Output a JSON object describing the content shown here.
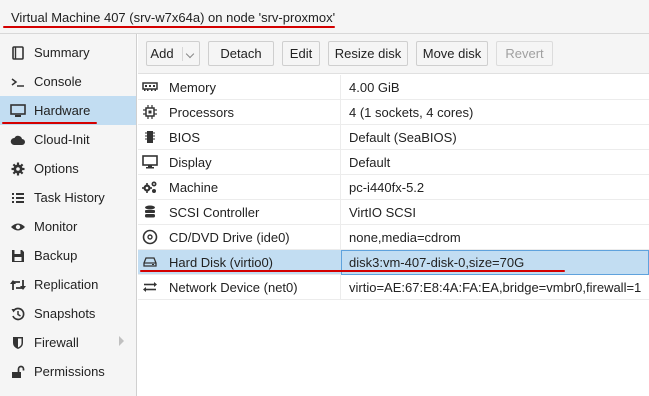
{
  "title": "Virtual Machine 407 (srv-w7x64a) on node 'srv-proxmox'",
  "colors": {
    "accent_selected": "#c2ddf2",
    "annotation_red": "#d40000",
    "focus_border": "#5fa2dd"
  },
  "sidebar": {
    "items": [
      {
        "label": "Summary",
        "icon": "book-icon"
      },
      {
        "label": "Console",
        "icon": "terminal-icon"
      },
      {
        "label": "Hardware",
        "icon": "monitor-icon",
        "active": true
      },
      {
        "label": "Cloud-Init",
        "icon": "cloud-icon"
      },
      {
        "label": "Options",
        "icon": "gear-icon"
      },
      {
        "label": "Task History",
        "icon": "list-icon"
      },
      {
        "label": "Monitor",
        "icon": "eye-icon"
      },
      {
        "label": "Backup",
        "icon": "floppy-icon"
      },
      {
        "label": "Replication",
        "icon": "retweet-icon"
      },
      {
        "label": "Snapshots",
        "icon": "history-icon"
      },
      {
        "label": "Firewall",
        "icon": "shield-icon"
      },
      {
        "label": "Permissions",
        "icon": "unlock-icon"
      }
    ]
  },
  "toolbar": {
    "add": "Add",
    "detach": "Detach",
    "edit": "Edit",
    "resize_disk": "Resize disk",
    "move_disk": "Move disk",
    "revert": "Revert"
  },
  "hardware": {
    "rows": [
      {
        "key": "Memory",
        "value": "4.00 GiB",
        "icon": "memory-icon"
      },
      {
        "key": "Processors",
        "value": "4 (1 sockets, 4 cores)",
        "icon": "cpu-icon"
      },
      {
        "key": "BIOS",
        "value": "Default (SeaBIOS)",
        "icon": "microchip-icon"
      },
      {
        "key": "Display",
        "value": "Default",
        "icon": "desktop-icon"
      },
      {
        "key": "Machine",
        "value": "pc-i440fx-5.2",
        "icon": "cogs-icon"
      },
      {
        "key": "SCSI Controller",
        "value": "VirtIO SCSI",
        "icon": "database-icon"
      },
      {
        "key": "CD/DVD Drive (ide0)",
        "value": "none,media=cdrom",
        "icon": "cdrom-icon"
      },
      {
        "key": "Hard Disk (virtio0)",
        "value": "disk3:vm-407-disk-0,size=70G",
        "icon": "hdd-icon",
        "selected": true
      },
      {
        "key": "Network Device (net0)",
        "value": "virtio=AE:67:E8:4A:FA:EA,bridge=vmbr0,firewall=1",
        "icon": "exchange-icon"
      }
    ]
  }
}
